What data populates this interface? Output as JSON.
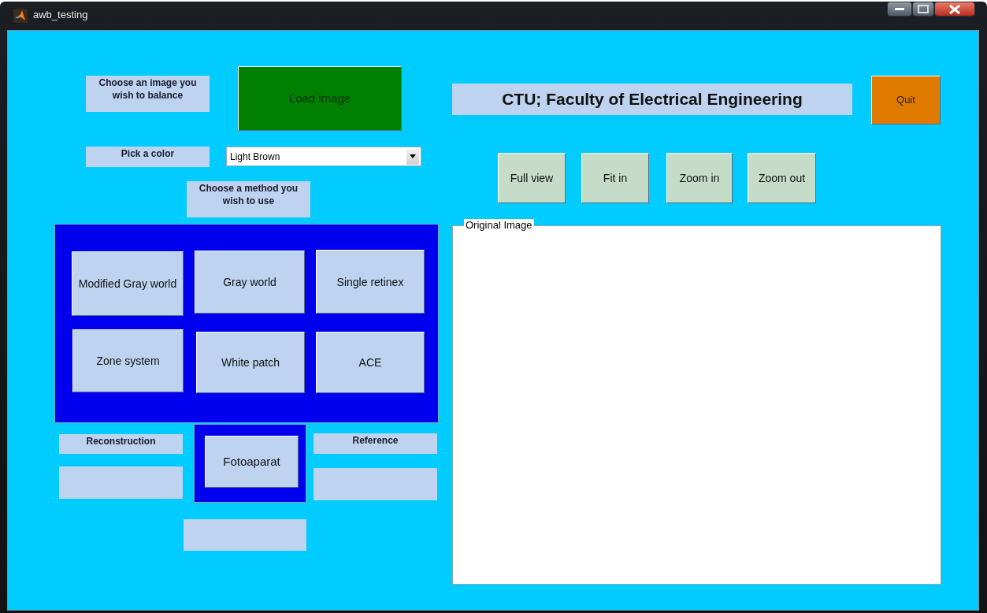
{
  "window": {
    "title": "awb_testing"
  },
  "header": "CTU; Faculty of Electrical Engineering",
  "labels": [
    {
      "text": "Choose an image you wish to balance"
    },
    {
      "text": "Pick a color"
    },
    {
      "text": "Choose a method you wish to use"
    },
    {
      "text": "Reconstruction"
    },
    {
      "text": "Reference"
    }
  ],
  "load_button": "Load image",
  "quit_button": "Quit",
  "color_dropdown": {
    "value": "Light Brown"
  },
  "view_buttons": [
    "Full view",
    "Fit in",
    "Zoom in",
    "Zoom out"
  ],
  "method_buttons": [
    "Modified Gray world",
    "Gray world",
    "Single retinex",
    "Zone system",
    "White patch",
    "ACE"
  ],
  "camera_button": "Fotoaparat",
  "image_panel": {
    "title": "Original Image"
  }
}
